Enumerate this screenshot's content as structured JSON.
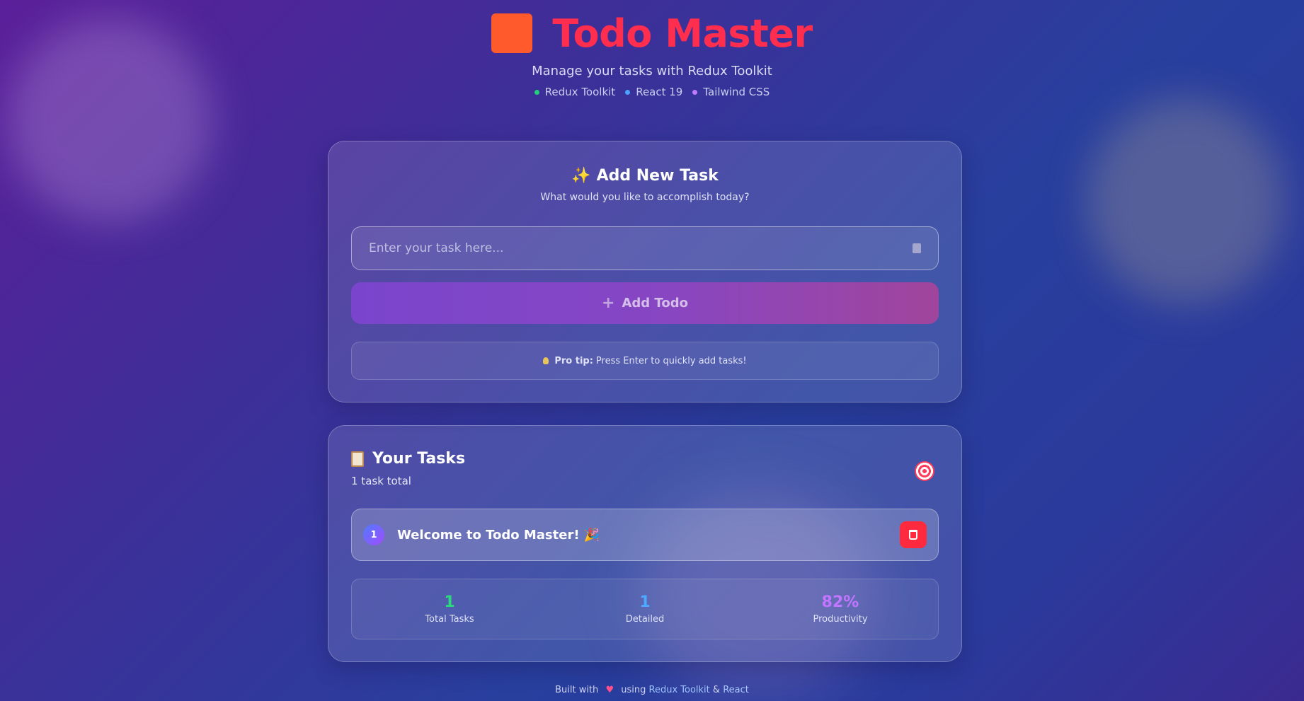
{
  "app": {
    "title": "Todo Master",
    "subtitle": "Manage your tasks with Redux Toolkit",
    "tech": [
      {
        "label": "Redux Toolkit",
        "color": "#22d07a"
      },
      {
        "label": "React 19",
        "color": "#4aa3ff"
      },
      {
        "label": "Tailwind CSS",
        "color": "#c07bff"
      }
    ]
  },
  "add_task": {
    "title": "Add New Task",
    "spark_icon": "✨",
    "subtitle": "What would you like to accomplish today?",
    "input_placeholder": "Enter your task here...",
    "input_value": "",
    "button_label": "Add Todo",
    "tip_strong": "Pro tip:",
    "tip_text": "Press Enter to quickly add tasks!"
  },
  "tasks": {
    "title": "Your Tasks",
    "count_text": "1 task total",
    "items": [
      {
        "number": "1",
        "text": "Welcome to Todo Master! 🎉"
      }
    ],
    "stats": [
      {
        "value": "1",
        "label": "Total Tasks",
        "color": "#2bd97f"
      },
      {
        "value": "1",
        "label": "Detailed",
        "color": "#4fa8ff"
      },
      {
        "value": "82%",
        "label": "Productivity",
        "color": "#c276ff"
      }
    ]
  },
  "footer": {
    "prefix": "Built with",
    "middle": "using",
    "link1": "Redux Toolkit",
    "amp": "&",
    "link2": "React"
  }
}
